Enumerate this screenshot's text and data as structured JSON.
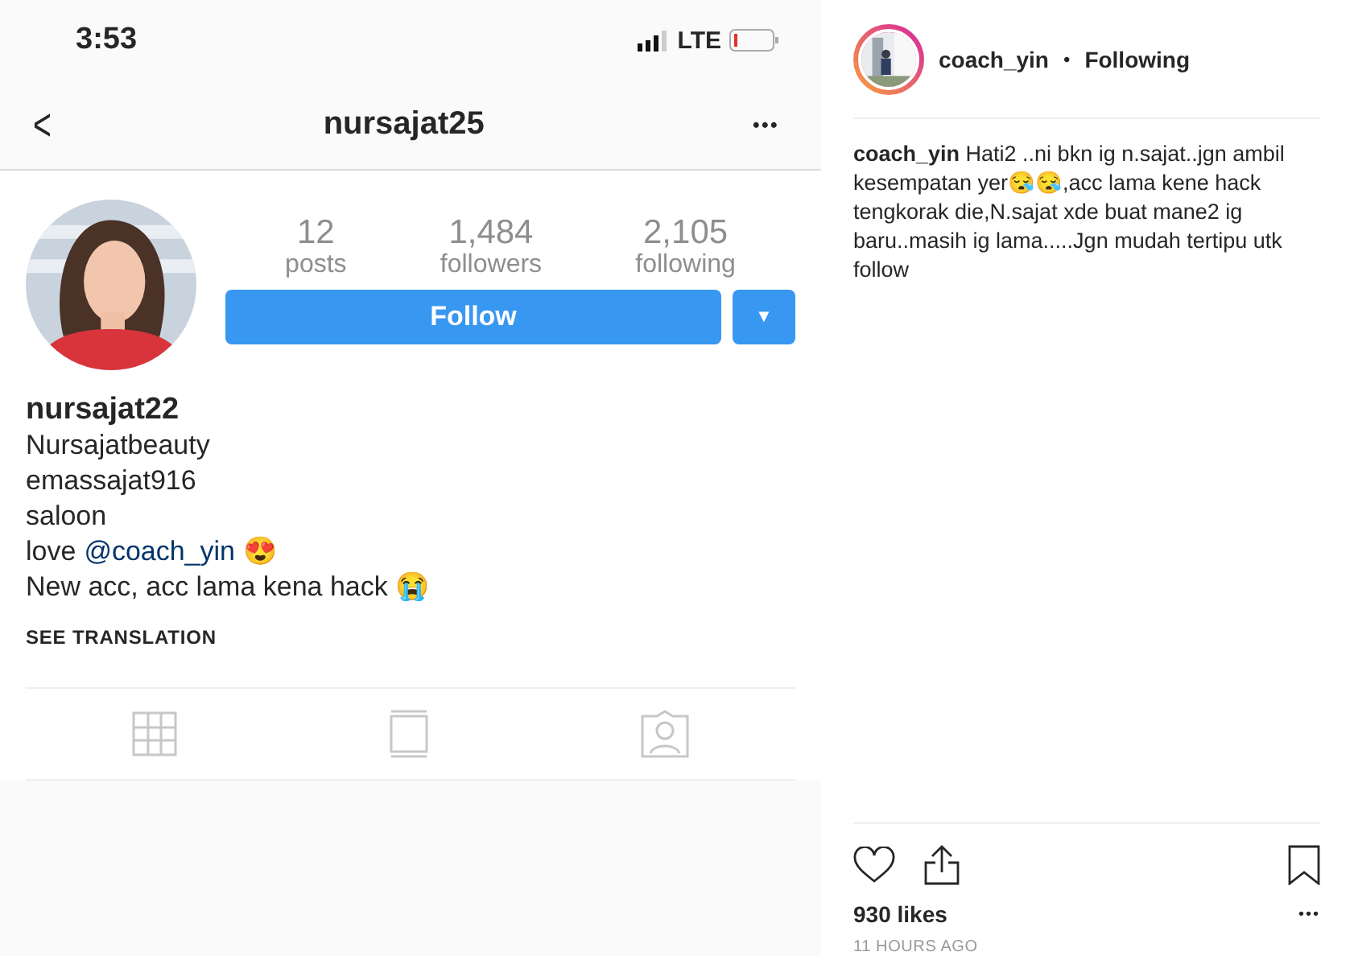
{
  "phone": {
    "status_bar": {
      "time": "3:53",
      "network": "LTE"
    },
    "nav": {
      "back": "<",
      "title": "nursajat25",
      "more": "•••"
    },
    "profile": {
      "stats": [
        {
          "value": "12",
          "label": "posts"
        },
        {
          "value": "1,484",
          "label": "followers"
        },
        {
          "value": "2,105",
          "label": "following"
        }
      ],
      "follow_button": "Follow",
      "dropdown": "▼",
      "name": "nursajat22",
      "bio": [
        {
          "kind": "plain",
          "text": "Nursajatbeauty"
        },
        {
          "kind": "plain",
          "text": "emassajat916"
        },
        {
          "kind": "plain",
          "text": "saloon"
        },
        {
          "kind": "mention",
          "before": "love",
          "link": "@coach_yin",
          "after": "😍"
        },
        {
          "kind": "plain",
          "text": "New acc, acc lama kena hack 😭"
        }
      ],
      "see_translation": "SEE TRANSLATION"
    },
    "tabs": [
      {
        "kind": "grid"
      },
      {
        "kind": "feed"
      },
      {
        "kind": "tagged"
      }
    ]
  },
  "post": {
    "username": "coach_yin",
    "separator": "•",
    "follow_state": "Following",
    "caption": "**coach_yin** Hati2 ..ni bkn ig n.sajat..jgn ambil kesempatan yer😪😪,acc lama kene hack tengkorak die,N.sajat xde buat mane2 ig baru..masih ig lama.....Jgn mudah tertipu utk follow",
    "likes": "930 likes",
    "more": "•••",
    "time": "11 HOURS AGO"
  }
}
